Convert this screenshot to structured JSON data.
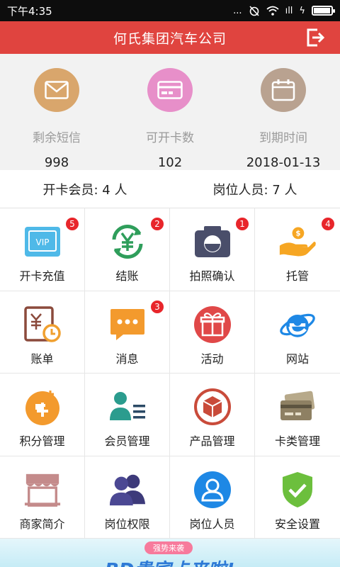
{
  "status_bar": {
    "time": "下午4:35",
    "dots": "...",
    "signal_glyph": "ıll",
    "bolt_glyph": "ϟ"
  },
  "header": {
    "title": "何氏集团汽车公司",
    "logout_icon": "logout-icon"
  },
  "stats": [
    {
      "icon": "mail-icon",
      "color": "#d9a66c",
      "label": "剩余短信",
      "value": "998"
    },
    {
      "icon": "card-icon",
      "color": "#e78fc9",
      "label": "可开卡数",
      "value": "102"
    },
    {
      "icon": "calendar-icon",
      "color": "#b9a290",
      "label": "到期时间",
      "value": "2018-01-13"
    }
  ],
  "summary": {
    "members": "开卡会员: 4 人",
    "staff": "岗位人员: 7 人"
  },
  "menu": [
    {
      "label": "开卡充值",
      "icon": "vip-card-icon",
      "badge": "5"
    },
    {
      "label": "结账",
      "icon": "yen-refresh-icon",
      "badge": "2"
    },
    {
      "label": "拍照确认",
      "icon": "camera-icon",
      "badge": "1"
    },
    {
      "label": "托管",
      "icon": "coin-hand-icon",
      "badge": "4"
    },
    {
      "label": "账单",
      "icon": "bill-clock-icon",
      "badge": ""
    },
    {
      "label": "消息",
      "icon": "message-icon",
      "badge": "3"
    },
    {
      "label": "活动",
      "icon": "gift-icon",
      "badge": ""
    },
    {
      "label": "网站",
      "icon": "browser-e-icon",
      "badge": ""
    },
    {
      "label": "积分管理",
      "icon": "points-plus-icon",
      "badge": ""
    },
    {
      "label": "会员管理",
      "icon": "member-list-icon",
      "badge": ""
    },
    {
      "label": "产品管理",
      "icon": "product-box-icon",
      "badge": ""
    },
    {
      "label": "卡类管理",
      "icon": "cards-icon",
      "badge": ""
    },
    {
      "label": "商家简介",
      "icon": "shop-awning-icon",
      "badge": ""
    },
    {
      "label": "岗位权限",
      "icon": "group-users-icon",
      "badge": ""
    },
    {
      "label": "岗位人员",
      "icon": "person-circle-icon",
      "badge": ""
    },
    {
      "label": "安全设置",
      "icon": "shield-check-icon",
      "badge": ""
    }
  ],
  "banner": {
    "tag": "强势来袭",
    "headline": "BD贵宾卡来啦!"
  },
  "colors": {
    "accent": "#e0443f",
    "badge": "#e8262b"
  }
}
